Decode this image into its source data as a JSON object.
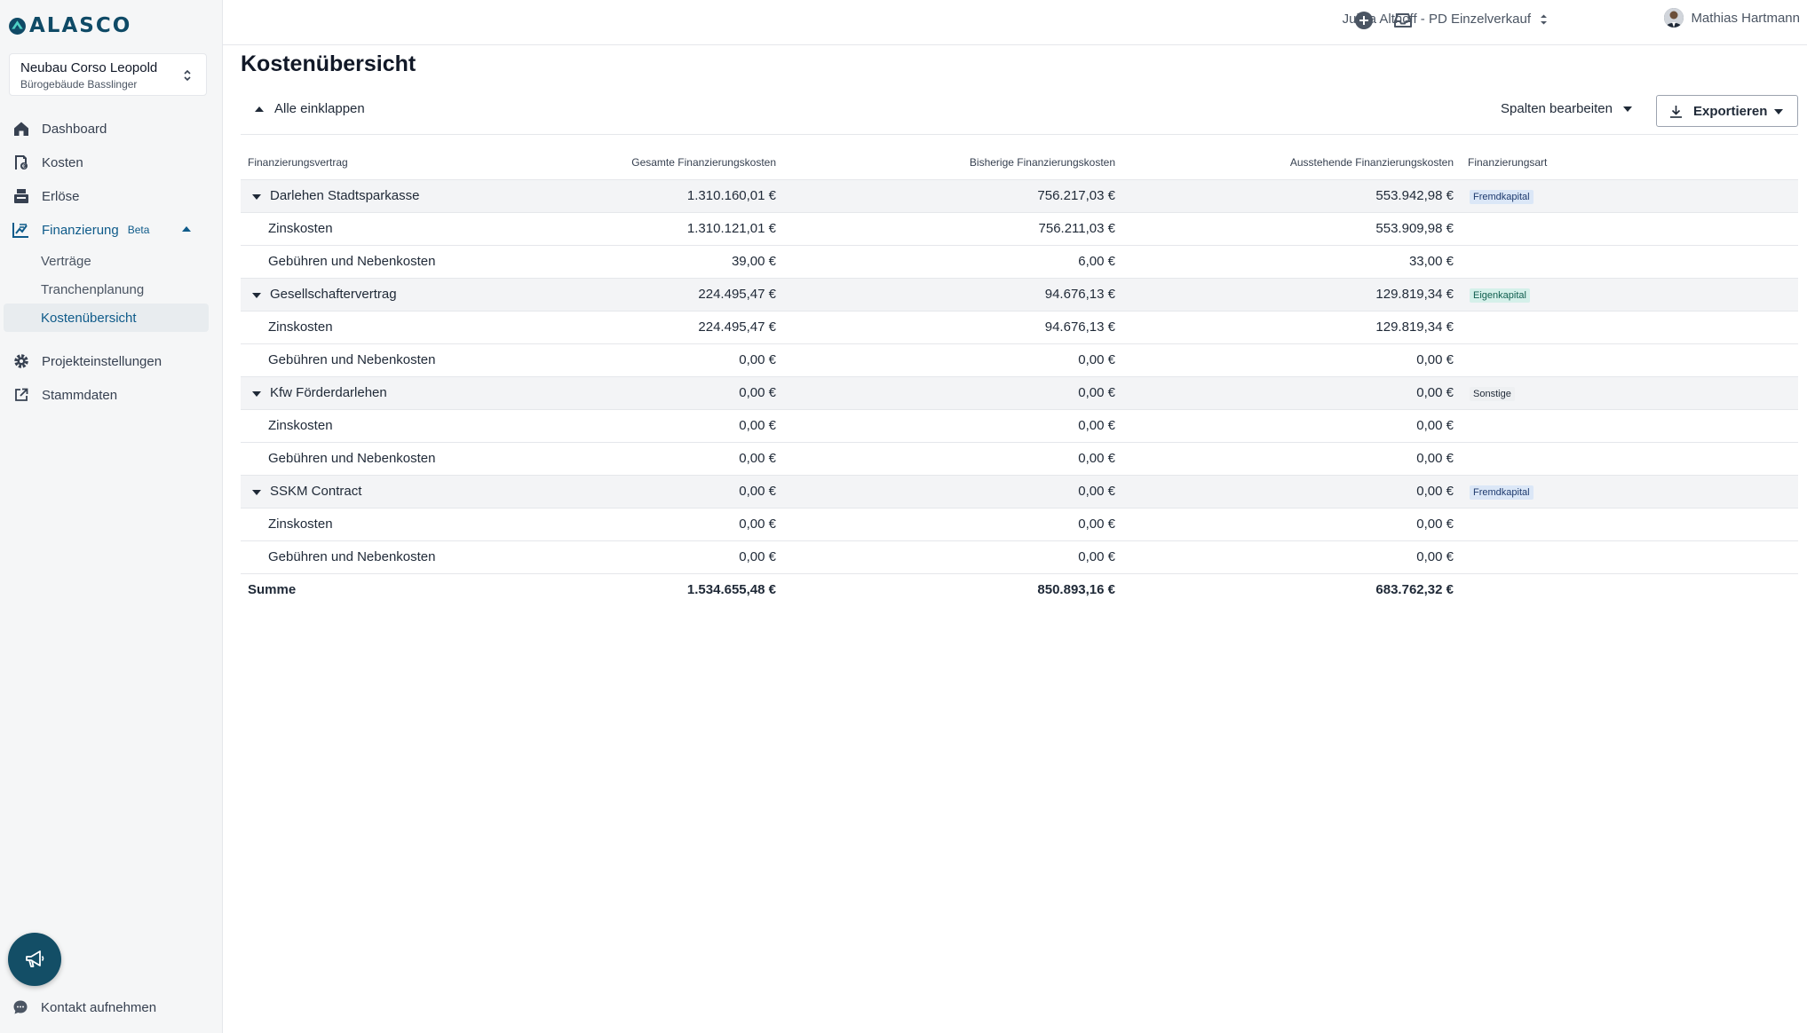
{
  "brand": {
    "name": "ALASCO",
    "color": "#0f4a66"
  },
  "project": {
    "name": "Neubau Corso Leopold",
    "subtitle": "Bürogebäude Basslinger"
  },
  "nav": {
    "dashboard": "Dashboard",
    "kosten": "Kosten",
    "erloese": "Erlöse",
    "finanzierung": "Finanzierung",
    "beta": "Beta",
    "sub": [
      "Verträge",
      "Tranchenplanung",
      "Kostenübersicht"
    ],
    "projekteinstellungen": "Projekteinstellungen",
    "stammdaten": "Stammdaten"
  },
  "contact": "Kontakt aufnehmen",
  "topbar": {
    "org": "Julika Althoff - PD Einzelverkauf",
    "user": "Mathias Hartmann"
  },
  "page": {
    "title": "Kostenübersicht",
    "collapse_all": "Alle einklappen",
    "edit_columns": "Spalten bearbeiten",
    "export": "Exportieren"
  },
  "table": {
    "headers": [
      "Finanzierungsvertrag",
      "Gesamte Finanzierungskosten",
      "Bisherige Finanzierungskosten",
      "Ausstehende Finanzierungskosten",
      "Finanzierungsart"
    ],
    "groups": [
      {
        "name": "Darlehen Stadtsparkasse",
        "total": "1.310.160,01 €",
        "past": "756.217,03 €",
        "outstanding": "553.942,98 €",
        "type": "Fremdkapital",
        "type_bg": "#dbe7f7",
        "type_fg": "#1e3a6e",
        "rows": [
          {
            "name": "Zinskosten",
            "total": "1.310.121,01 €",
            "past": "756.211,03 €",
            "outstanding": "553.909,98 €"
          },
          {
            "name": "Gebühren und Nebenkosten",
            "total": "39,00 €",
            "past": "6,00 €",
            "outstanding": "33,00 €"
          }
        ]
      },
      {
        "name": "Gesellschaftervertrag",
        "total": "224.495,47 €",
        "past": "94.676,13 €",
        "outstanding": "129.819,34 €",
        "type": "Eigenkapital",
        "type_bg": "#d5f0ea",
        "type_fg": "#115e4f",
        "rows": [
          {
            "name": "Zinskosten",
            "total": "224.495,47 €",
            "past": "94.676,13 €",
            "outstanding": "129.819,34 €"
          },
          {
            "name": "Gebühren und Nebenkosten",
            "total": "0,00 €",
            "past": "0,00 €",
            "outstanding": "0,00 €"
          }
        ]
      },
      {
        "name": "Kfw Förderdarlehen",
        "total": "0,00 €",
        "past": "0,00 €",
        "outstanding": "0,00 €",
        "type": "Sonstige",
        "type_bg": "#eef0f2",
        "type_fg": "#1f2937",
        "rows": [
          {
            "name": "Zinskosten",
            "total": "0,00 €",
            "past": "0,00 €",
            "outstanding": "0,00 €"
          },
          {
            "name": "Gebühren und Nebenkosten",
            "total": "0,00 €",
            "past": "0,00 €",
            "outstanding": "0,00 €"
          }
        ]
      },
      {
        "name": "SSKM Contract",
        "total": "0,00 €",
        "past": "0,00 €",
        "outstanding": "0,00 €",
        "type": "Fremdkapital",
        "type_bg": "#dbe7f7",
        "type_fg": "#1e3a6e",
        "rows": [
          {
            "name": "Zinskosten",
            "total": "0,00 €",
            "past": "0,00 €",
            "outstanding": "0,00 €"
          },
          {
            "name": "Gebühren und Nebenkosten",
            "total": "0,00 €",
            "past": "0,00 €",
            "outstanding": "0,00 €"
          }
        ]
      }
    ],
    "sum": {
      "label": "Summe",
      "total": "1.534.655,48 €",
      "past": "850.893,16 €",
      "outstanding": "683.762,32 €"
    }
  }
}
